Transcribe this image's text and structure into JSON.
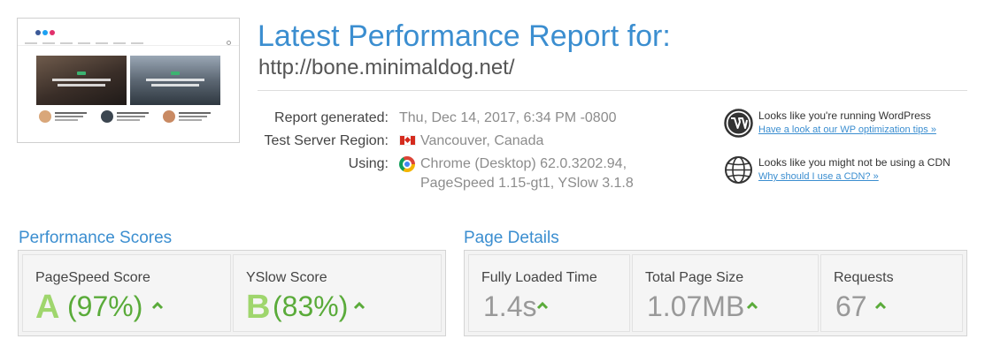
{
  "header": {
    "title": "Latest Performance Report for:",
    "url": "http://bone.minimaldog.net/"
  },
  "info": {
    "report_generated_label": "Report generated:",
    "report_generated_value": "Thu, Dec 14, 2017, 6:34 PM -0800",
    "region_label": "Test Server Region:",
    "region_value": "Vancouver, Canada",
    "using_label": "Using:",
    "using_line1": "Chrome (Desktop) 62.0.3202.94,",
    "using_line2": "PageSpeed 1.15-gt1, YSlow 3.1.8"
  },
  "notices": {
    "wordpress_text": "Looks like you're running WordPress",
    "wordpress_link": "Have a look at our WP optimization tips »",
    "cdn_text": "Looks like you might not be using a CDN",
    "cdn_link": "Why should I use a CDN? »"
  },
  "performance_scores": {
    "title": "Performance Scores",
    "pagespeed_label": "PageSpeed Score",
    "pagespeed_grade": "A",
    "pagespeed_pct": "(97%)",
    "yslow_label": "YSlow Score",
    "yslow_grade": "B",
    "yslow_pct": "(83%)"
  },
  "page_details": {
    "title": "Page Details",
    "loaded_label": "Fully Loaded Time",
    "loaded_value": "1.4s",
    "size_label": "Total Page Size",
    "size_value": "1.07MB",
    "requests_label": "Requests",
    "requests_value": "67"
  },
  "icons": {
    "wordpress": "wordpress-icon",
    "cdn": "globe-icon",
    "flag": "canada-flag-icon",
    "browser": "chrome-icon",
    "trend": "caret-up-icon"
  },
  "colors": {
    "accent": "#3b8ed0",
    "good": "#5aab3a",
    "grade": "#9fd66d"
  }
}
